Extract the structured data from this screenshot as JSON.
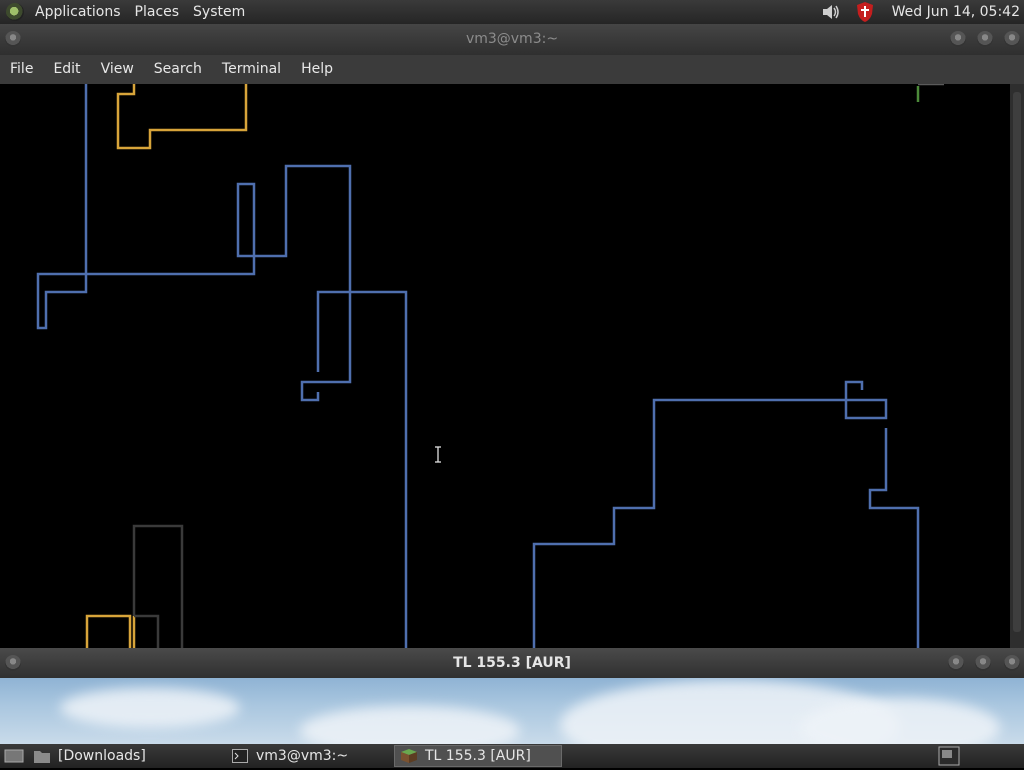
{
  "top_panel": {
    "menus": [
      "Applications",
      "Places",
      "System"
    ],
    "clock": "Wed Jun 14, 05:42",
    "icons": [
      "gnome-foot-icon",
      "volume-icon",
      "shield-icon"
    ]
  },
  "terminal_window": {
    "title": "vm3@vm3:~",
    "menu": [
      "File",
      "Edit",
      "View",
      "Search",
      "Terminal",
      "Help"
    ]
  },
  "second_window": {
    "title": "TL 155.3 [AUR]"
  },
  "taskbar": {
    "tasks": [
      {
        "label": "[Downloads]",
        "icon": "folder-icon"
      },
      {
        "label": "vm3@vm3:~",
        "icon": "terminal-icon"
      },
      {
        "label": "TL 155.3 [AUR]",
        "icon": "minecraft-block-icon"
      }
    ]
  },
  "colors": {
    "blue_track": "#4f6fae",
    "yellow_track": "#d7a43a",
    "dark_track": "#3a3a3a",
    "green_mark": "#4c8a3a"
  }
}
